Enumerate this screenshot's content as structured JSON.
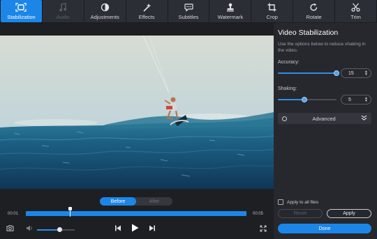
{
  "toolbar": {
    "tabs": [
      {
        "label": "Stabilization",
        "icon": "stabilization-icon",
        "state": "active"
      },
      {
        "label": "Audio",
        "icon": "music-note-icon",
        "state": "disabled"
      },
      {
        "label": "Adjustments",
        "icon": "contrast-icon",
        "state": "normal"
      },
      {
        "label": "Effects",
        "icon": "magic-wand-icon",
        "state": "normal"
      },
      {
        "label": "Subtitles",
        "icon": "speech-bubble-icon",
        "state": "normal"
      },
      {
        "label": "Watermark",
        "icon": "stamp-icon",
        "state": "normal"
      },
      {
        "label": "Crop",
        "icon": "crop-icon",
        "state": "normal"
      },
      {
        "label": "Rotate",
        "icon": "rotate-icon",
        "state": "normal"
      },
      {
        "label": "Trim",
        "icon": "scissors-icon",
        "state": "normal"
      }
    ]
  },
  "panel": {
    "title": "Video Stabilization",
    "description": "Use the options below to reduce shaking in the video.",
    "accuracy": {
      "label": "Accuracy:",
      "value": "15",
      "level": 1.0
    },
    "shaking": {
      "label": "Shaking:",
      "value": "5",
      "level": 0.45
    },
    "advanced_label": "Advanced",
    "apply_all_label": "Apply to all files",
    "apply_all_checked": false,
    "reset_label": "Reset",
    "apply_label": "Apply",
    "done_label": "Done"
  },
  "player": {
    "before_label": "Before",
    "after_label": "After",
    "active_view": "Before",
    "time_start": "00:01",
    "time_end": "00:05",
    "progress": 0.2,
    "volume": 0.6
  },
  "colors": {
    "accent": "#1c86e8",
    "background": "#1d1f23",
    "panel": "#26282d"
  }
}
